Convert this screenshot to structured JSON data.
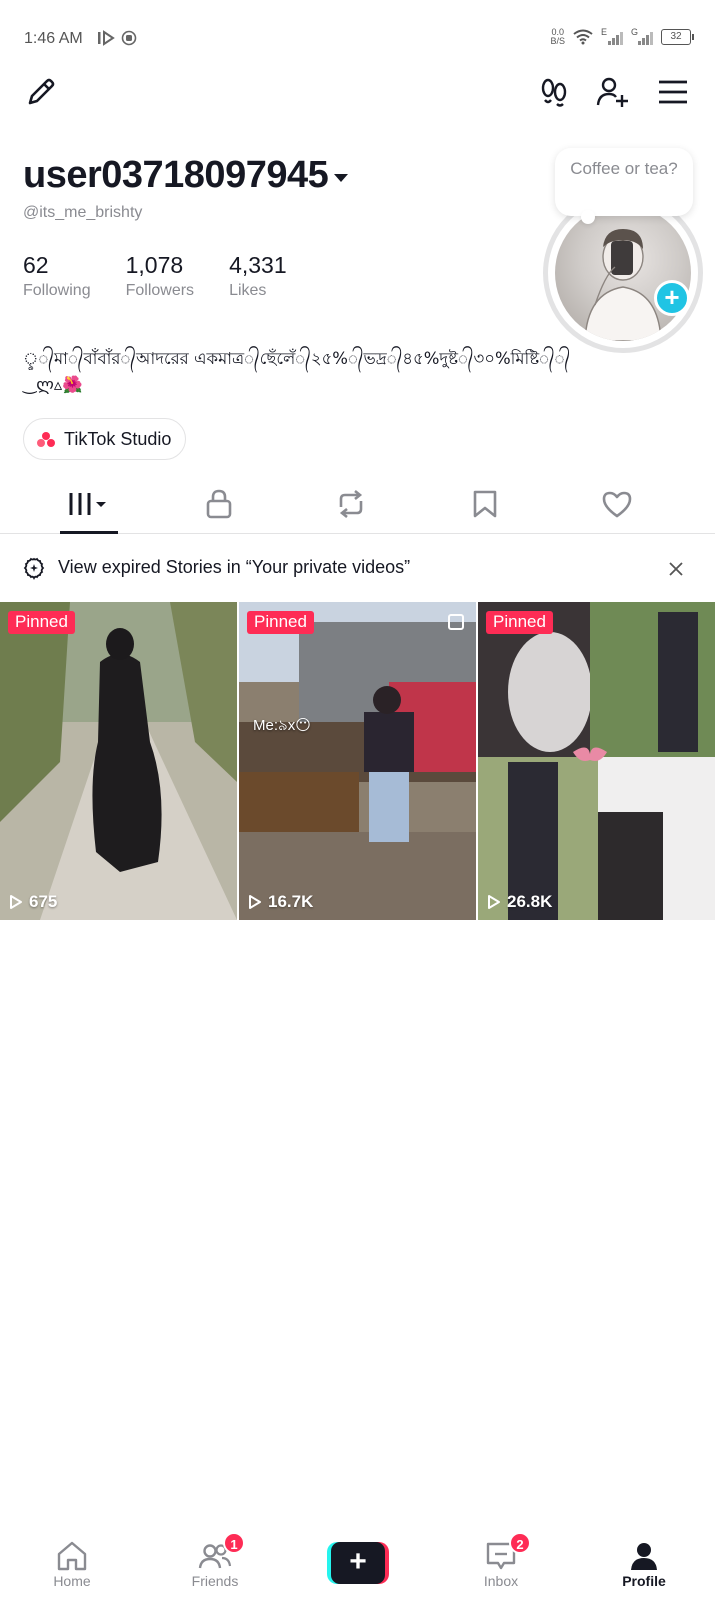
{
  "status_bar": {
    "time": "1:46 AM",
    "net_speed_top": "0.0",
    "net_speed_bottom": "B/S",
    "signal1_label": "E",
    "signal2_label": "G",
    "battery": "32"
  },
  "profile": {
    "username": "user03718097945",
    "handle": "@its_me_brishty",
    "note": "Coffee or tea?",
    "stats": [
      {
        "value": "62",
        "label": "Following"
      },
      {
        "value": "1,078",
        "label": "Followers"
      },
      {
        "value": "4,331",
        "label": "Likes"
      }
    ],
    "bio": "ৢ᭄মা᭄বাঁবাঁর᭄আদরের একমাত্র᭄ছেঁলেঁ᭄২৫%᭄ভদ্র᭄৪৫%দুষ্ট᭄৩০%মিষ্টি᭄᭄\n‿ლ▵🌺",
    "studio_label": "TikTok Studio"
  },
  "banner": {
    "text": "View expired Stories in “Your private videos”"
  },
  "videos": [
    {
      "pinned": "Pinned",
      "views": "675",
      "overlay": ""
    },
    {
      "pinned": "Pinned",
      "views": "16.7K",
      "overlay": "Me:৯x😶"
    },
    {
      "pinned": "Pinned",
      "views": "26.8K",
      "overlay": ""
    }
  ],
  "nav": {
    "home": "Home",
    "friends": "Friends",
    "friends_badge": "1",
    "inbox": "Inbox",
    "inbox_badge": "2",
    "profile": "Profile"
  },
  "colors": {
    "accent": "#fe2c55",
    "cyan": "#25f4ee",
    "avatar_plus": "#20c4e4",
    "text_primary": "#161823",
    "text_secondary": "#8a8b91"
  }
}
